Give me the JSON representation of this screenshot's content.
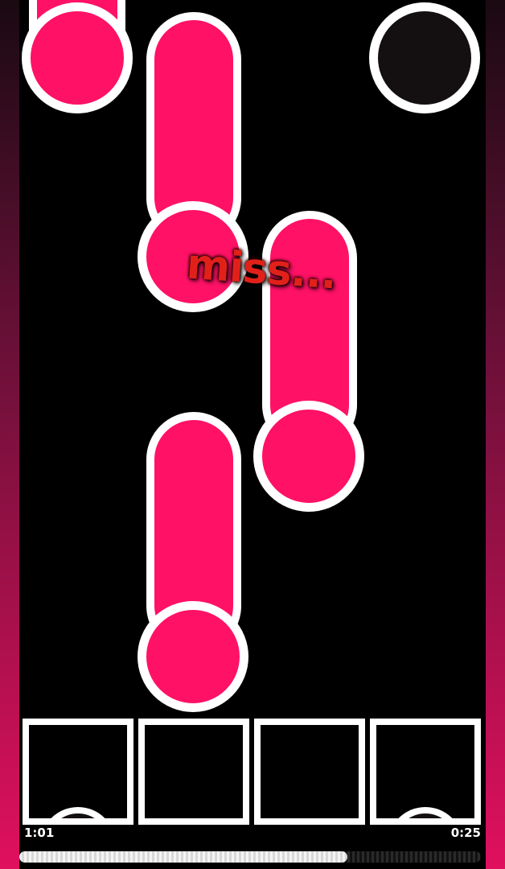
{
  "game": {
    "judgement_text": "miss...",
    "elapsed_time": "1:01",
    "remaining_time": "0:25",
    "progress_fraction": 0.71,
    "colors": {
      "note": "#ff1166",
      "outline": "#ffffff",
      "background": "#000000"
    },
    "lanes": [
      "lane-1",
      "lane-2",
      "lane-3",
      "lane-4"
    ]
  }
}
